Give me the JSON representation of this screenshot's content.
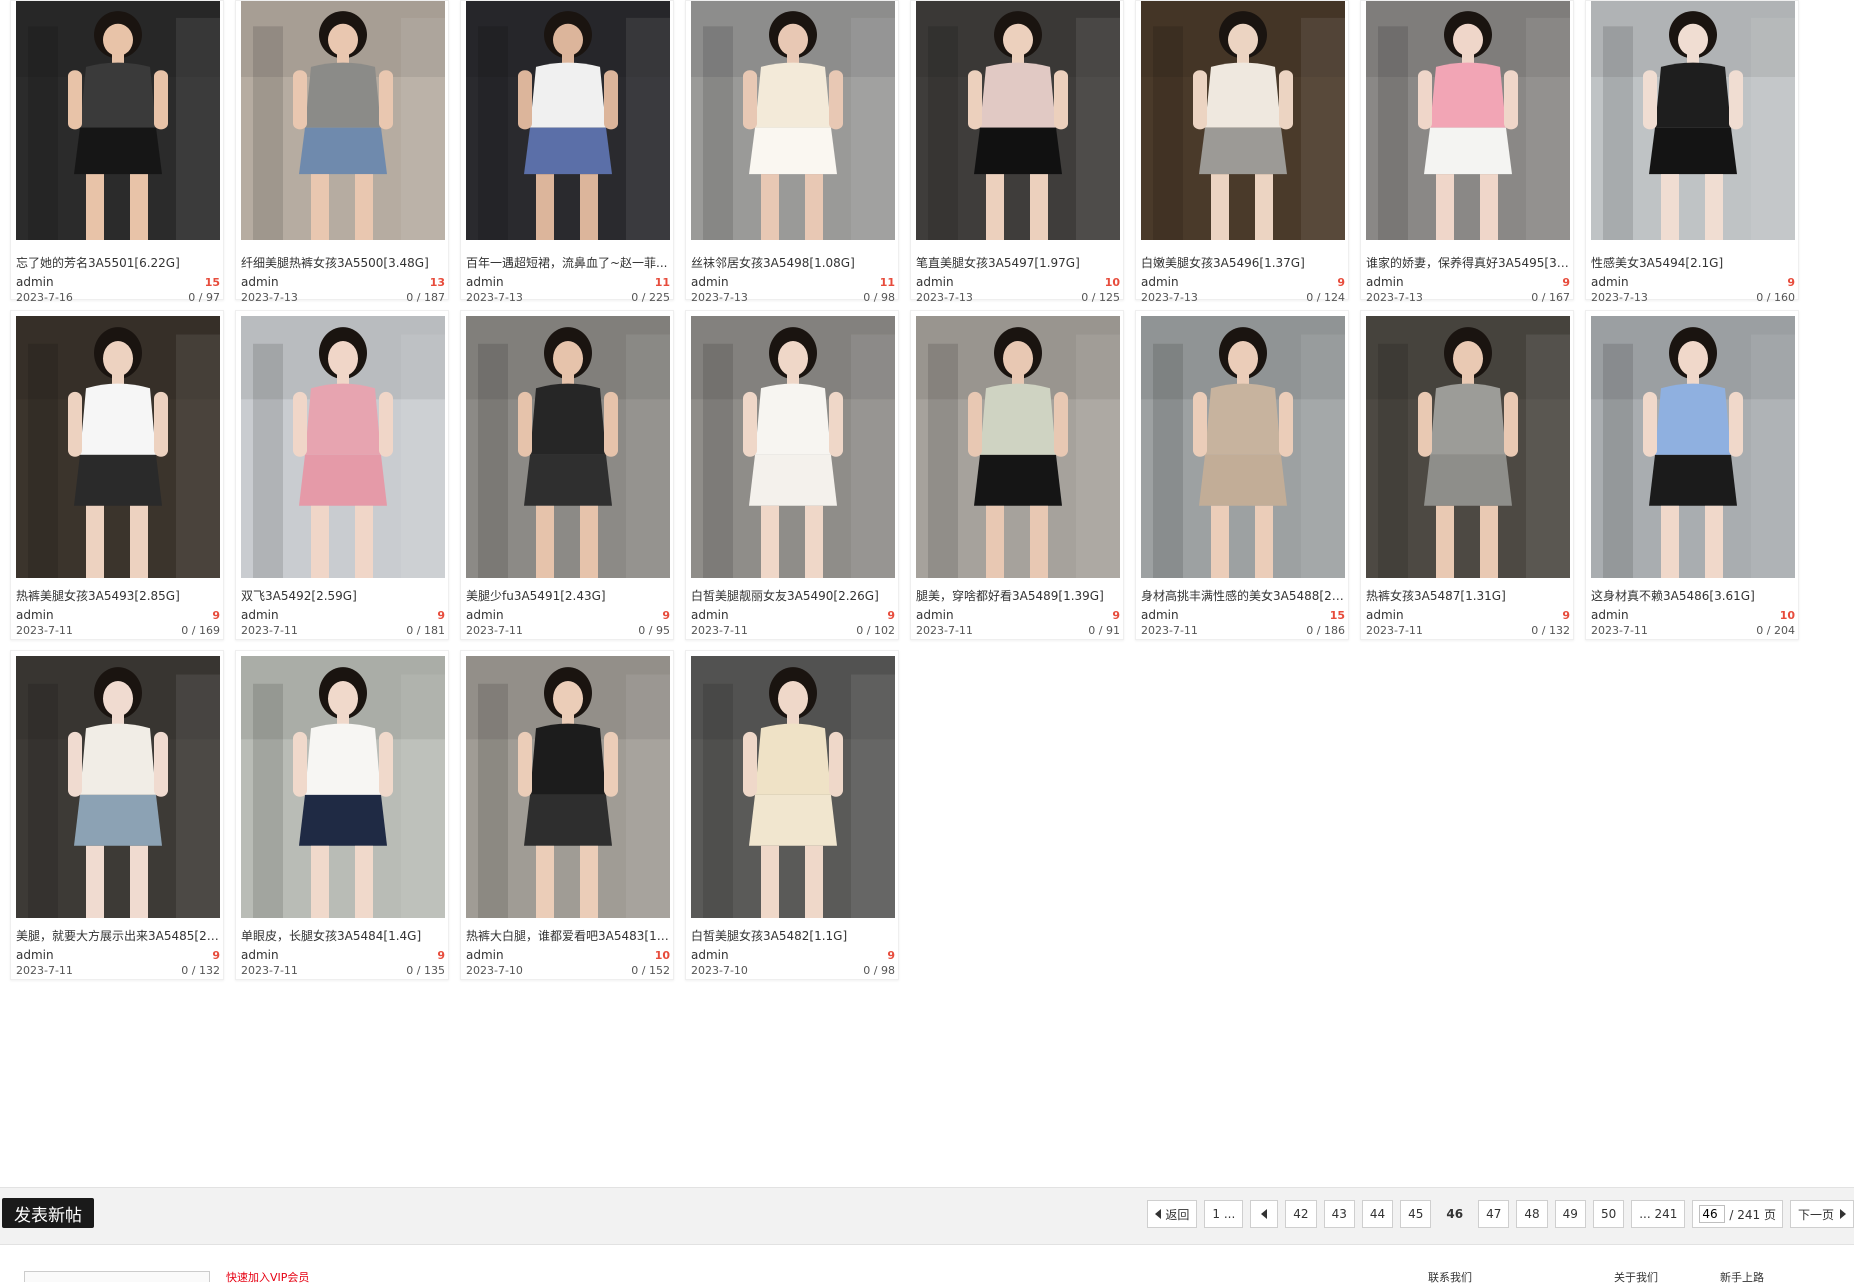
{
  "cards": [
    {
      "title": "忘了她的芳名3A5501[6.22G]",
      "author": "admin",
      "count": "15",
      "date": "2023-7-16",
      "stats": "0 / 97",
      "bg": "#2b2b2b",
      "top": "#3a3a3a",
      "outfit": "#161616",
      "skin": "#e8c3a8"
    },
    {
      "title": "纤细美腿热裤女孩3A5500[3.48G]",
      "author": "admin",
      "count": "13",
      "date": "2023-7-13",
      "stats": "0 / 187",
      "bg": "#b6aca1",
      "top": "#8b8b88",
      "outfit": "#6f8aad",
      "skin": "#e9c7b0"
    },
    {
      "title": "百年一遇超短裙，流鼻血了~赵一菲...",
      "author": "admin",
      "count": "11",
      "date": "2023-7-13",
      "stats": "0 / 225",
      "bg": "#2a2a2e",
      "top": "#f0f0f0",
      "outfit": "#5b6fa8",
      "skin": "#dcb59b"
    },
    {
      "title": "丝袜邻居女孩3A5498[1.08G]",
      "author": "admin",
      "count": "11",
      "date": "2023-7-13",
      "stats": "0 / 98",
      "bg": "#9a9a98",
      "top": "#f3ead9",
      "outfit": "#faf7f1",
      "skin": "#e8c8b4"
    },
    {
      "title": "笔直美腿女孩3A5497[1.97G]",
      "author": "admin",
      "count": "10",
      "date": "2023-7-13",
      "stats": "0 / 125",
      "bg": "#3f3d3b",
      "top": "#e1c9c4",
      "outfit": "#111111",
      "skin": "#ecd0bd"
    },
    {
      "title": "白嫩美腿女孩3A5496[1.37G]",
      "author": "admin",
      "count": "9",
      "date": "2023-7-13",
      "stats": "0 / 124",
      "bg": "#4a3a2a",
      "top": "#efe8df",
      "outfit": "#9c9a96",
      "skin": "#ecd4c2"
    },
    {
      "title": "谁家的娇妻，保养得真好3A5495[3....",
      "author": "admin",
      "count": "9",
      "date": "2023-7-13",
      "stats": "0 / 167",
      "bg": "#8a8886",
      "top": "#f2a5b5",
      "outfit": "#f4f4f2",
      "skin": "#efd6c9"
    },
    {
      "title": "性感美女3A5494[2.1G]",
      "author": "admin",
      "count": "9",
      "date": "2023-7-13",
      "stats": "0 / 160",
      "bg": "#bfc3c5",
      "top": "#1e1e1e",
      "outfit": "#141414",
      "skin": "#f0ddd2"
    },
    {
      "title": "热裤美腿女孩3A5493[2.85G]",
      "author": "admin",
      "count": "9",
      "date": "2023-7-11",
      "stats": "0 / 169",
      "bg": "#3b342c",
      "top": "#f6f6f6",
      "outfit": "#2a2a2a",
      "skin": "#edd2c0"
    },
    {
      "title": "双飞3A5492[2.59G]",
      "author": "admin",
      "count": "9",
      "date": "2023-7-11",
      "stats": "0 / 181",
      "bg": "#c9ccd0",
      "top": "#e7a4b0",
      "outfit": "#e59aa8",
      "skin": "#f0d6c8"
    },
    {
      "title": "美腿少fu3A5491[2.43G]",
      "author": "admin",
      "count": "9",
      "date": "2023-7-11",
      "stats": "0 / 95",
      "bg": "#8c8a86",
      "top": "#262626",
      "outfit": "#2f2f2f",
      "skin": "#e6c3ab"
    },
    {
      "title": "白皙美腿靓丽女友3A5490[2.26G]",
      "author": "admin",
      "count": "9",
      "date": "2023-7-11",
      "stats": "0 / 102",
      "bg": "#8f8d89",
      "top": "#f7f5f1",
      "outfit": "#f4f1ec",
      "skin": "#efd7c8"
    },
    {
      "title": "腿美，穿啥都好看3A5489[1.39G]",
      "author": "admin",
      "count": "9",
      "date": "2023-7-11",
      "stats": "0 / 91",
      "bg": "#a6a29c",
      "top": "#cfd3c2",
      "outfit": "#151515",
      "skin": "#e8c8b3"
    },
    {
      "title": "身材高挑丰满性感的美女3A5488[2....",
      "author": "admin",
      "count": "15",
      "date": "2023-7-11",
      "stats": "0 / 186",
      "bg": "#9da1a2",
      "top": "#c7b39e",
      "outfit": "#c2ad97",
      "skin": "#ebcdb9"
    },
    {
      "title": "热裤女孩3A5487[1.31G]",
      "author": "admin",
      "count": "9",
      "date": "2023-7-11",
      "stats": "0 / 132",
      "bg": "#4d4943",
      "top": "#9c9c98",
      "outfit": "#8e8e8a",
      "skin": "#e9c9b3"
    },
    {
      "title": "这身材真不赖3A5486[3.61G]",
      "author": "admin",
      "count": "10",
      "date": "2023-7-11",
      "stats": "0 / 204",
      "bg": "#a9adb0",
      "top": "#8fb0e0",
      "outfit": "#1b1b1b",
      "skin": "#f0d8ca"
    },
    {
      "title": "美腿，就要大方展示出来3A5485[2....",
      "author": "admin",
      "count": "9",
      "date": "2023-7-11",
      "stats": "0 / 132",
      "bg": "#3d3a36",
      "top": "#f1ede6",
      "outfit": "#8ca2b4",
      "skin": "#f0dbd0"
    },
    {
      "title": "单眼皮，长腿女孩3A5484[1.4G]",
      "author": "admin",
      "count": "9",
      "date": "2023-7-11",
      "stats": "0 / 135",
      "bg": "#b9bcb6",
      "top": "#f7f6f3",
      "outfit": "#1f2a44",
      "skin": "#f0d9cb"
    },
    {
      "title": "热裤大白腿，谁都爱看吧3A5483[1....",
      "author": "admin",
      "count": "10",
      "date": "2023-7-10",
      "stats": "0 / 152",
      "bg": "#a09c95",
      "top": "#1c1c1c",
      "outfit": "#2e2e2e",
      "skin": "#ebcdb8"
    },
    {
      "title": "白皙美腿女孩3A5482[1.1G]",
      "author": "admin",
      "count": "9",
      "date": "2023-7-10",
      "stats": "0 / 98",
      "bg": "#5a5a58",
      "top": "#efe2c6",
      "outfit": "#f1e6cf",
      "skin": "#efd8c9"
    }
  ],
  "toolbar": {
    "new_post": "发表新帖",
    "back": "返回",
    "first": "1 ...",
    "pages": [
      "42",
      "43",
      "44",
      "45"
    ],
    "current": "46",
    "pages_after": [
      "47",
      "48",
      "49",
      "50"
    ],
    "last": "... 241",
    "jump_value": "46",
    "jump_total": "/ 241 页",
    "next": "下一页"
  },
  "footer": {
    "red_text": "快速加入VIP会员",
    "links": [
      "联系我们",
      "关于我们",
      "新手上路"
    ]
  }
}
